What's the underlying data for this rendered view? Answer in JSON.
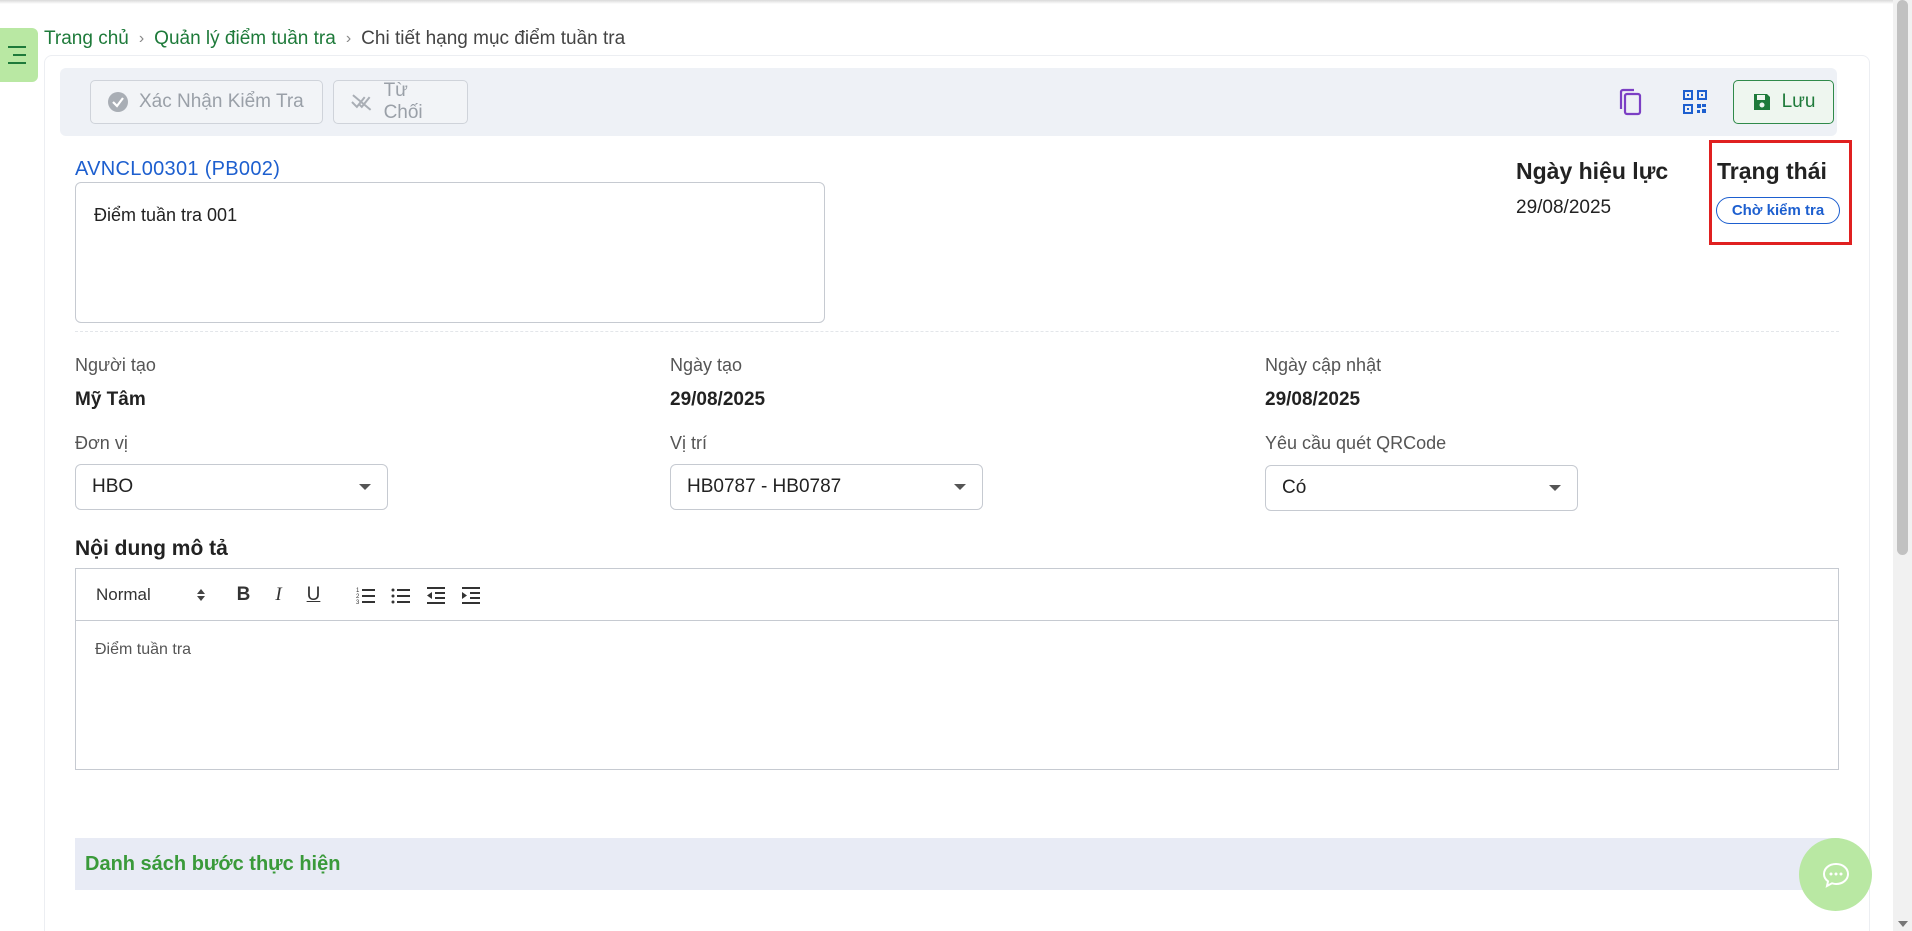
{
  "breadcrumb": {
    "home": "Trang chủ",
    "parent": "Quản lý điểm tuần tra",
    "current": "Chi tiết hạng mục điểm tuần tra"
  },
  "toolbar": {
    "confirm_label": "Xác Nhận Kiểm Tra",
    "reject_label": "Từ Chối",
    "save_label": "Lưu"
  },
  "record": {
    "code": "AVNCL00301",
    "group_code": "(PB002)",
    "name": "Điểm tuần tra 001"
  },
  "effective": {
    "label": "Ngày hiệu lực",
    "date": "29/08/2025"
  },
  "status": {
    "label": "Trạng thái",
    "value": "Chờ kiểm tra",
    "color": "#1d5fcf"
  },
  "info": {
    "creator_label": "Người tạo",
    "creator_value": "Mỹ Tâm",
    "created_label": "Ngày tạo",
    "created_value": "29/08/2025",
    "updated_label": "Ngày cập nhật",
    "updated_value": "29/08/2025"
  },
  "fields": {
    "unit_label": "Đơn vị",
    "unit_value": "HBO",
    "location_label": "Vị trí",
    "location_value": "HB0787 - HB0787",
    "qr_label": "Yêu cầu quét QRCode",
    "qr_value": "Có"
  },
  "description": {
    "title": "Nội dung mô tả",
    "format": "Normal",
    "content": "Điểm tuần tra"
  },
  "steps": {
    "title": "Danh sách bước thực hiện"
  },
  "colors": {
    "accent_green": "#1e7a3a",
    "menu_green": "#b9e8a3",
    "link_blue": "#1d5fcf",
    "highlight_red": "#e02020"
  }
}
